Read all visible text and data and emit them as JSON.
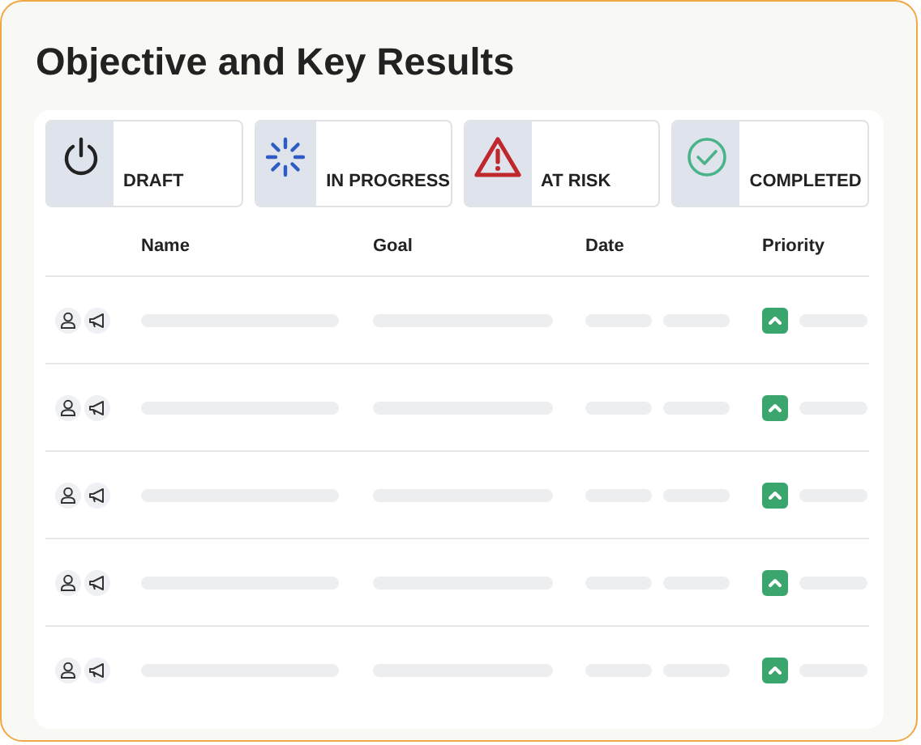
{
  "title": "Objective and Key Results",
  "statuses": [
    {
      "kind": "draft",
      "label": "DRAFT"
    },
    {
      "kind": "in_progress",
      "label": "IN PROGRESS"
    },
    {
      "kind": "at_risk",
      "label": "AT RISK"
    },
    {
      "kind": "completed",
      "label": "COMPLETED"
    }
  ],
  "table": {
    "columns": [
      "Name",
      "Goal",
      "Date",
      "Priority"
    ],
    "rows": [
      {
        "kind": "placeholder"
      },
      {
        "kind": "placeholder"
      },
      {
        "kind": "placeholder"
      },
      {
        "kind": "placeholder"
      },
      {
        "kind": "placeholder"
      }
    ]
  }
}
